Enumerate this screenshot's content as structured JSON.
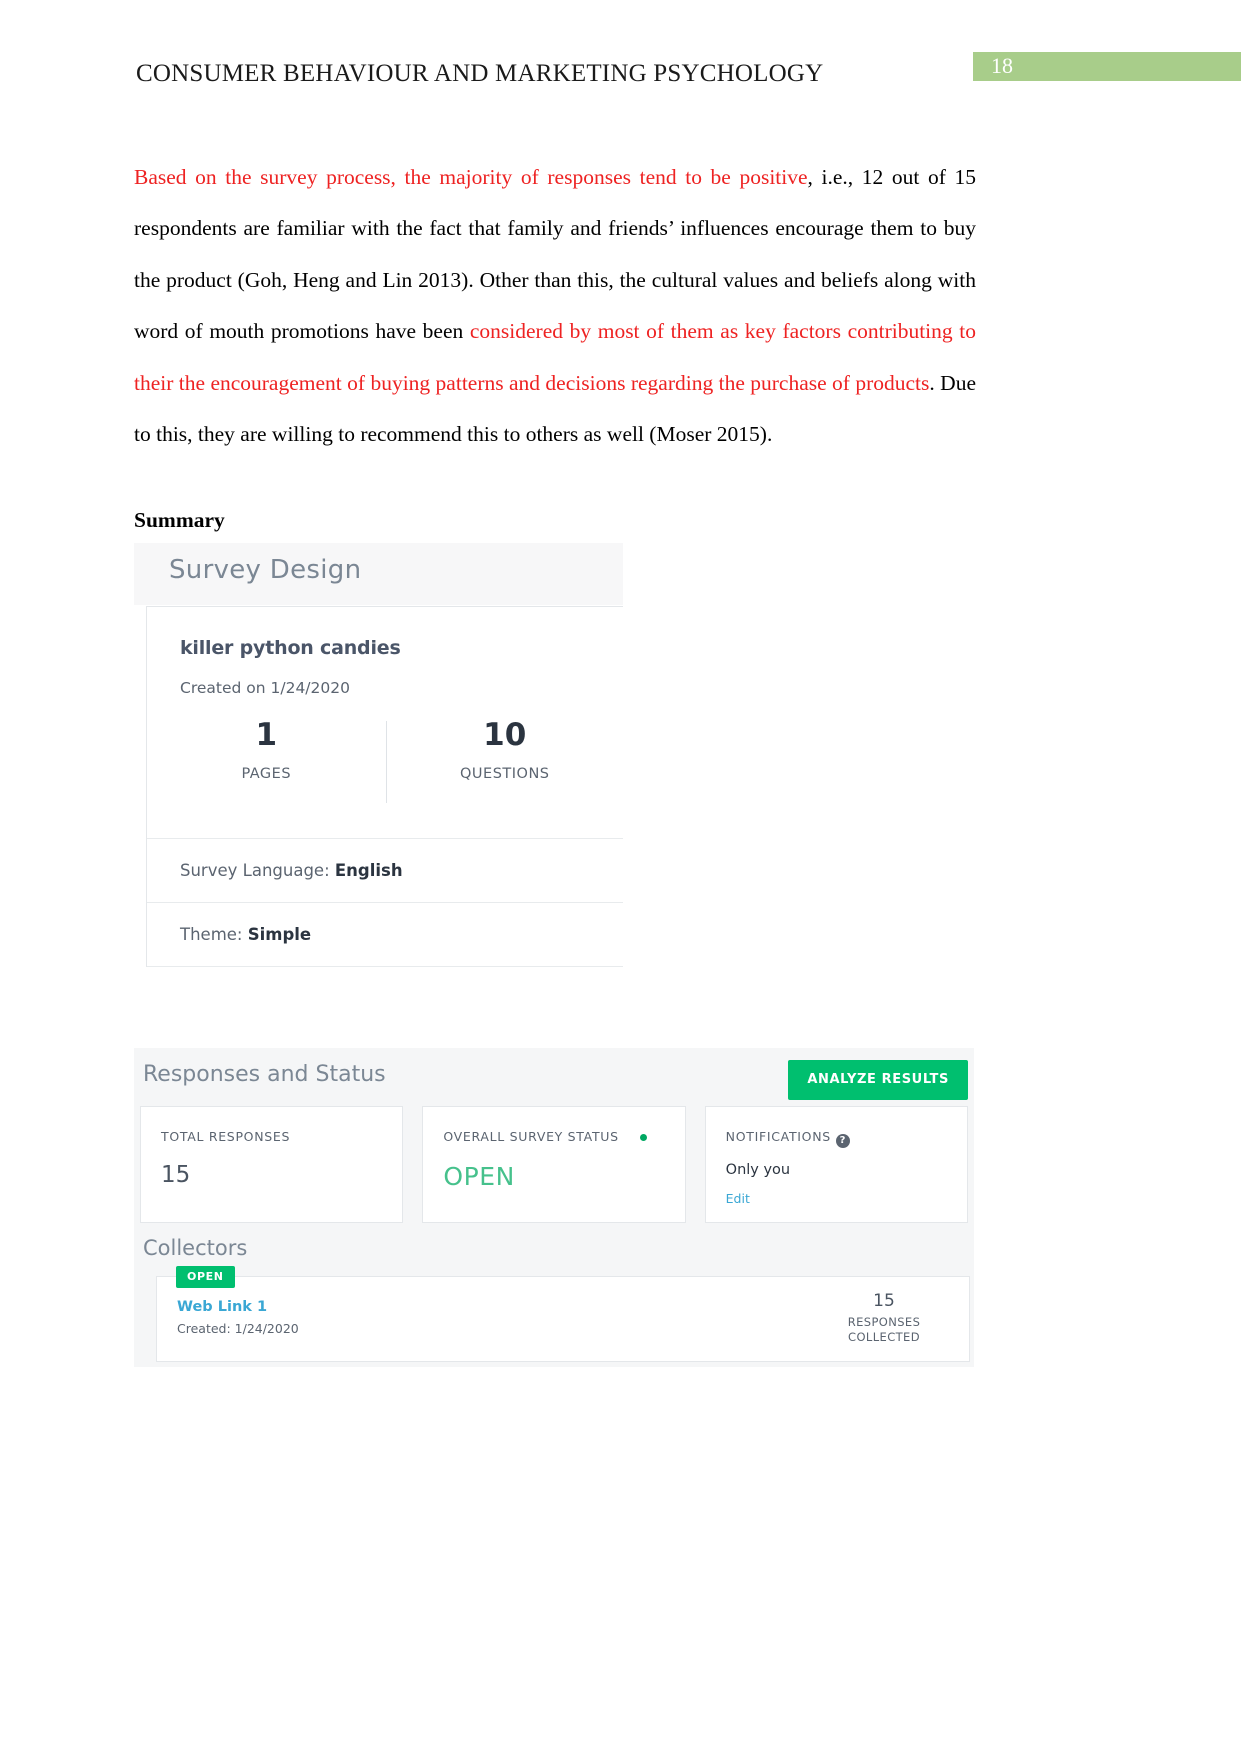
{
  "header": {
    "doc_title": "CONSUMER BEHAVIOUR AND MARKETING PSYCHOLOGY",
    "page_number": "18",
    "badge_color": "#a8cd8a"
  },
  "body": {
    "para_seg1_red": "Based on the survey process, the majority of responses tend to be positive",
    "para_seg2_black": ", i.e., 12 out of 15 respondents are familiar with the fact that family and friends’ influences encourage them to buy the product (Goh, Heng and Lin 2013). Other than this, the cultural values and beliefs along with word of mouth promotions have been ",
    "para_seg3_red": "considered by most of them as key factors contributing to their the encouragement of buying patterns and decisions regarding the purchase of products",
    "para_seg4_black": ". Due to this, they are willing to recommend this to others as well (Moser 2015).",
    "section_heading": "Summary"
  },
  "survey_design": {
    "header_title": "Survey Design",
    "survey_name": "killer python candies",
    "created_on": "Created on 1/24/2020",
    "stats": [
      {
        "value": "1",
        "label": "PAGES"
      },
      {
        "value": "10",
        "label": "QUESTIONS"
      }
    ],
    "language_label": "Survey Language: ",
    "language_value": "English",
    "theme_label": "Theme: ",
    "theme_value": "Simple"
  },
  "responses_status": {
    "header_title": "Responses and Status",
    "analyze_button": "ANALYZE RESULTS",
    "analyze_button_color": "#00bf6f",
    "panels": {
      "total_responses_label": "TOTAL RESPONSES",
      "total_responses_value": "15",
      "overall_status_label": "OVERALL SURVEY STATUS",
      "overall_status_value": "OPEN",
      "overall_status_color": "#46c18c",
      "notifications_label": "NOTIFICATIONS",
      "notifications_value": "Only you",
      "notifications_edit": "Edit"
    },
    "collectors": {
      "title": "Collectors",
      "status_badge": "OPEN",
      "link_name": "Web Link 1",
      "created": "Created: 1/24/2020",
      "count": "15",
      "count_label_line1": "RESPONSES",
      "count_label_line2": "COLLECTED"
    }
  }
}
